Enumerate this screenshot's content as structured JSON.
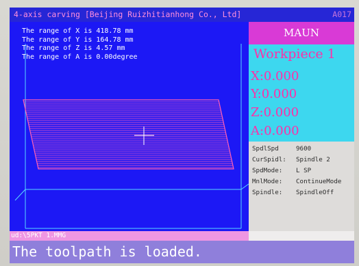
{
  "titlebar": {
    "title": "4-axis carving [Beijing Ruizhitianhong Co., Ltd]",
    "right_text": "A017"
  },
  "view": {
    "info_lines": [
      "The range of X is 418.78 mm",
      "The range of Y is 164.78 mm",
      "The range of Z is 4.57 mm",
      "The range of A is 0.00degree"
    ]
  },
  "panel": {
    "header": "MAUN",
    "workpiece": "Workpiece 1",
    "axes": [
      {
        "label": "X:0.000"
      },
      {
        "label": "Y:0.000"
      },
      {
        "label": "Z:0.000"
      },
      {
        "label": "A:0.000"
      }
    ],
    "status": [
      {
        "key": "SpdlSpd",
        "value": "9600"
      },
      {
        "key": "CurSpidl:",
        "value": "Spindle 2"
      },
      {
        "key": "SpdMode:",
        "value": "L SP"
      },
      {
        "key": "MnlMode:",
        "value": "ContinueMode"
      },
      {
        "key": "Spindle:",
        "value": "SpindleOff"
      }
    ]
  },
  "path_bar": {
    "path": "ud:\\5PKT 1.MMG"
  },
  "message": {
    "text": "The toolpath is loaded."
  },
  "colors": {
    "screen_bg": "#1a1aee",
    "header_magenta": "#d93ad6",
    "coords_cyan": "#3dd7ef",
    "coords_text": "#ff2fa8",
    "toolpath": "#ff5fb4",
    "message_bg": "#8f7fdb"
  },
  "icons": [
    "crosshair-icon"
  ]
}
